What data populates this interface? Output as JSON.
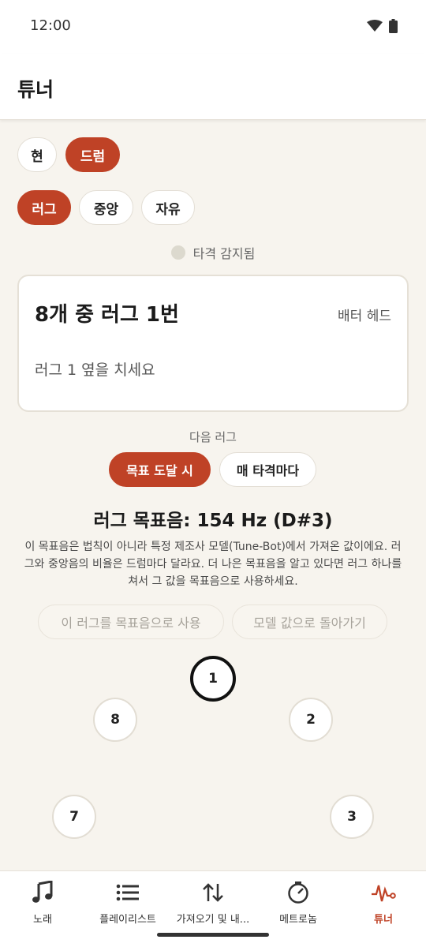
{
  "status": {
    "time": "12:00"
  },
  "app": {
    "title": "튜너"
  },
  "instrument_tabs": [
    {
      "label": "현",
      "active": false
    },
    {
      "label": "드럼",
      "active": true
    }
  ],
  "mode_tabs": [
    {
      "label": "러그",
      "active": true
    },
    {
      "label": "중앙",
      "active": false
    },
    {
      "label": "자유",
      "active": false
    }
  ],
  "detection": {
    "label": "타격 감지됨"
  },
  "card": {
    "heading": "8개 중 러그 1번",
    "head_type": "배터 헤드",
    "instruction": "러그 1 옆을 치세요"
  },
  "next_lug": {
    "label": "다음 러그",
    "options": [
      {
        "label": "목표 도달 시",
        "active": true
      },
      {
        "label": "매 타격마다",
        "active": false
      }
    ]
  },
  "target": {
    "text": "러그 목표음: 154 Hz (D#3)",
    "explanation": "이 목표음은 법칙이 아니라 특정 제조사 모델(Tune-Bot)에서 가져온 값이에요. 러그와 중앙음의 비율은 드럼마다 달라요. 더 나은 목표음을 알고 있다면 러그 하나를 쳐서 그 값을 목표음으로 사용하세요.",
    "use_button": "이 러그를 목표음으로 사용",
    "reset_button": "모델 값으로 돌아가기"
  },
  "lugs": [
    "1",
    "2",
    "3",
    "7",
    "8"
  ],
  "current_lug": "1",
  "bottom_nav": [
    {
      "label": "노래",
      "icon": "music-note-icon",
      "active": false
    },
    {
      "label": "플레이리스트",
      "icon": "list-icon",
      "active": false
    },
    {
      "label": "가져오기 및 내...",
      "icon": "import-export-icon",
      "active": false
    },
    {
      "label": "메트로놈",
      "icon": "metronome-icon",
      "active": false
    },
    {
      "label": "튜너",
      "icon": "waveform-icon",
      "active": true
    }
  ],
  "colors": {
    "accent": "#bf4226",
    "background": "#f7f4ee",
    "surface": "#ffffff"
  }
}
